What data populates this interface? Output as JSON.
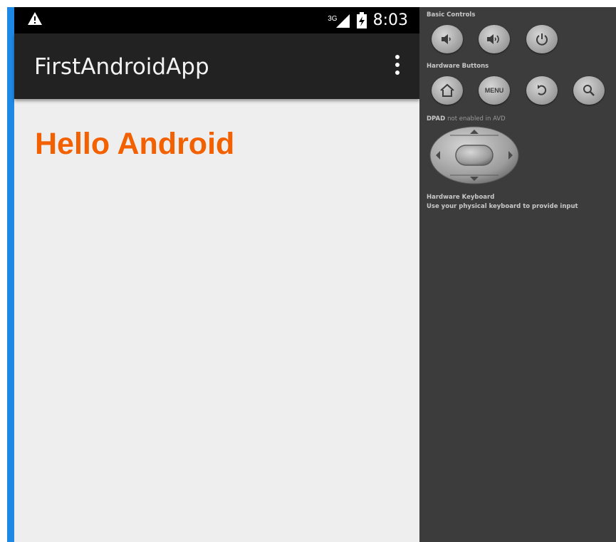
{
  "status_bar": {
    "network_label": "3G",
    "time": "8:03",
    "icons": [
      "warning-icon",
      "signal-icon",
      "battery-icon"
    ]
  },
  "action_bar": {
    "title": "FirstAndroidApp",
    "overflow_icon": "overflow-menu-icon"
  },
  "content": {
    "text": "Hello Android",
    "text_color": "#f26000"
  },
  "emulator_panel": {
    "basic_controls_title": "Basic Controls",
    "basic_controls": [
      "volume-down-icon",
      "volume-up-icon",
      "power-icon"
    ],
    "hardware_buttons_title": "Hardware Buttons",
    "menu_label": "MENU",
    "hardware_buttons": [
      "home-icon",
      "menu-button",
      "back-icon",
      "search-icon"
    ],
    "dpad_title": "DPAD",
    "dpad_note": "not enabled in AVD",
    "keyboard_title": "Hardware Keyboard",
    "keyboard_desc": "Use your physical keyboard to provide input"
  },
  "colors": {
    "accent_border": "#1e88e5",
    "action_bar": "#222222",
    "panel": "#3c3c3c",
    "content_bg": "#eeeeee"
  }
}
